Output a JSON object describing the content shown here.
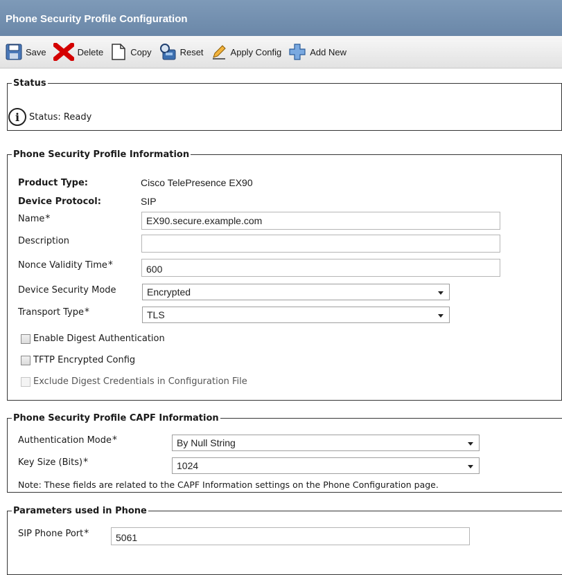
{
  "header": {
    "title": "Phone Security Profile Configuration"
  },
  "toolbar": {
    "save": "Save",
    "delete": "Delete",
    "copy": "Copy",
    "reset": "Reset",
    "apply_config": "Apply Config",
    "add_new": "Add New"
  },
  "status": {
    "legend": "Status",
    "icon": "info-icon",
    "text": "Status: Ready"
  },
  "profile_info": {
    "legend": "Phone Security Profile Information",
    "product_type_label": "Product Type:",
    "product_type_value": "Cisco TelePresence EX90",
    "device_protocol_label": "Device Protocol:",
    "device_protocol_value": "SIP",
    "name_label": "Name",
    "name_value": "EX90.secure.example.com",
    "description_label": "Description",
    "description_value": "",
    "nonce_label": "Nonce Validity Time",
    "nonce_value": "600",
    "security_mode_label": "Device Security Mode",
    "security_mode_value": "Encrypted",
    "transport_label": "Transport Type",
    "transport_value": "TLS",
    "digest_auth_label": "Enable Digest Authentication",
    "digest_auth_checked": false,
    "tftp_label": "TFTP Encrypted Config",
    "tftp_checked": false,
    "exclude_digest_label": "Exclude Digest Credentials in Configuration File",
    "exclude_digest_checked": false,
    "exclude_digest_disabled": true
  },
  "capf": {
    "legend": "Phone Security Profile CAPF Information",
    "auth_mode_label": "Authentication Mode",
    "auth_mode_value": "By Null String",
    "key_size_label": "Key Size (Bits)",
    "key_size_value": "1024",
    "note": "Note: These fields are related to the CAPF Information settings on the Phone Configuration page."
  },
  "params": {
    "legend": "Parameters used in Phone",
    "sip_port_label": "SIP Phone Port",
    "sip_port_value": "5061"
  },
  "required_mark": "*"
}
